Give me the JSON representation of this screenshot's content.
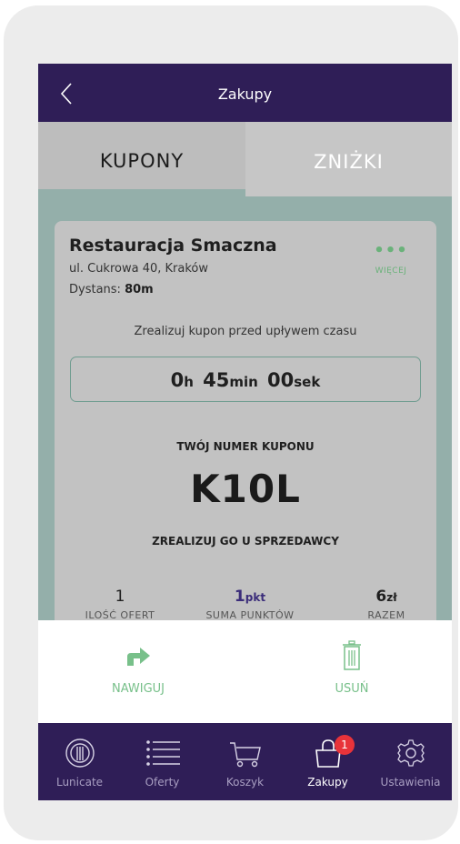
{
  "header": {
    "title": "Zakupy"
  },
  "tabs": {
    "coupons": "KUPONY",
    "discounts": "ZNIŻKI"
  },
  "card": {
    "restaurant_name": "Restauracja Smaczna",
    "address": "ul. Cukrowa 40, Kraków",
    "distance_label": "Dystans:",
    "distance_value": "80m",
    "more_label": "WIĘCEJ",
    "hint": "Zrealizuj kupon przed upływem czasu",
    "timer": {
      "hours": "0",
      "hours_unit": "h",
      "minutes": "45",
      "minutes_unit": "min",
      "seconds": "00",
      "seconds_unit": "sek"
    },
    "code_label": "TWÓJ NUMER KUPONU",
    "code_value": "K10L",
    "code_sub": "ZREALIZUJ GO U SPRZEDAWCY",
    "stats": [
      {
        "value": "1",
        "unit": "",
        "label": "ILOŚĆ OFERT"
      },
      {
        "value": "1",
        "unit": "pkt",
        "label": "SUMA PUNKTÓW"
      },
      {
        "value": "6",
        "unit": "zł",
        "label": "RAZEM"
      }
    ]
  },
  "actions": {
    "navigate": "NAWIGUJ",
    "delete": "USUŃ"
  },
  "bottom_nav": {
    "items": [
      {
        "label": "Lunicate",
        "icon": "lunicate-logo-icon"
      },
      {
        "label": "Oferty",
        "icon": "list-icon"
      },
      {
        "label": "Koszyk",
        "icon": "cart-icon"
      },
      {
        "label": "Zakupy",
        "icon": "shopping-bag-icon",
        "badge": "1"
      },
      {
        "label": "Ustawienia",
        "icon": "gear-icon"
      }
    ]
  },
  "colors": {
    "header_bg": "#2f1e57",
    "accent_green": "#78c08a",
    "badge_red": "#e8333a",
    "screen_bg": "#94afaa"
  }
}
